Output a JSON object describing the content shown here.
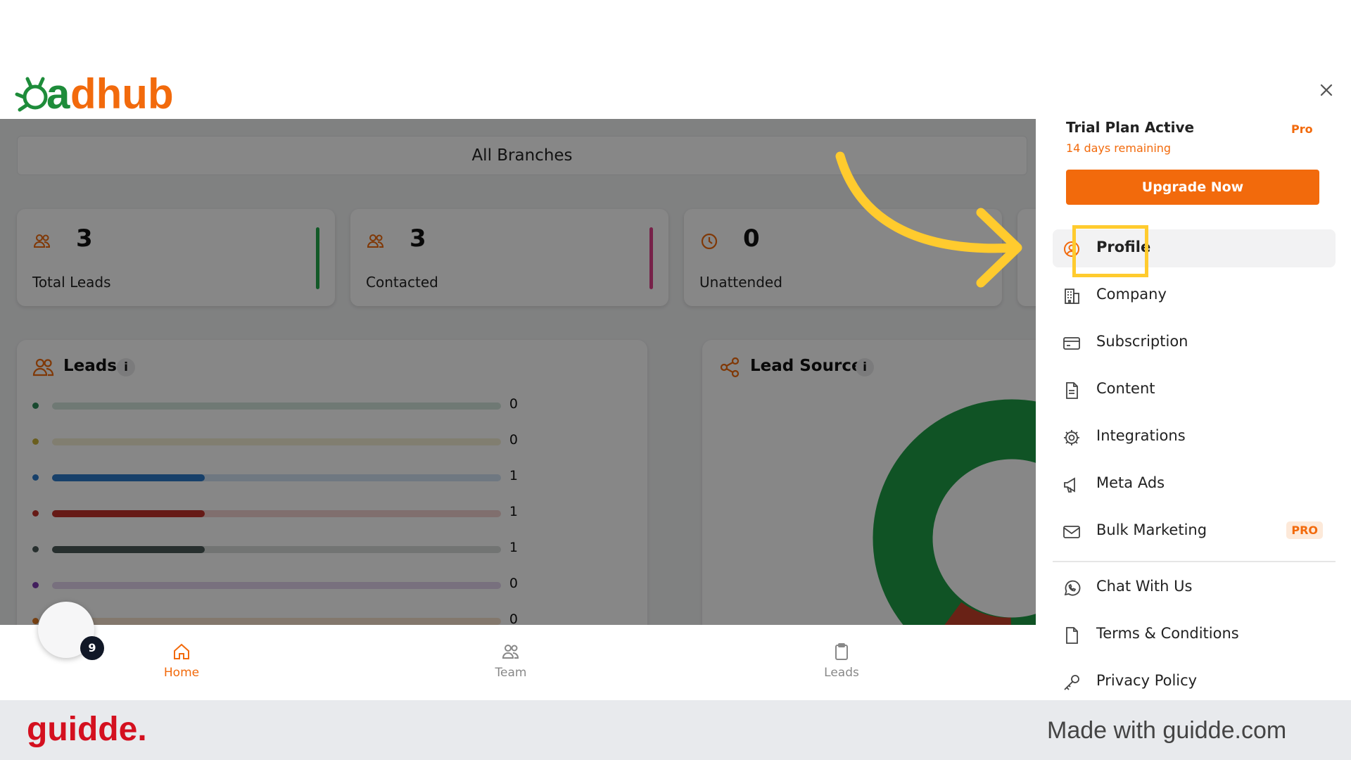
{
  "app": {
    "logo_text": "adhub",
    "brand_color": "#f26a0c",
    "logo_green": "#1e8c3a"
  },
  "filter": {
    "branch_label": "All Branches"
  },
  "stats": [
    {
      "value": "3",
      "label": "Total Leads",
      "icon": "users-icon",
      "bar_color": "#22a84b"
    },
    {
      "value": "3",
      "label": "Contacted",
      "icon": "users-icon",
      "bar_color": "#e0408a"
    },
    {
      "value": "0",
      "label": "Unattended",
      "icon": "clock-icon",
      "bar_color": "#e0a020"
    }
  ],
  "leads_panel": {
    "title": "Leads",
    "info": "i",
    "rows": [
      {
        "value": "0",
        "fraction": 0,
        "color": "#2e8a5a"
      },
      {
        "value": "0",
        "fraction": 0,
        "color": "#c9b23a"
      },
      {
        "value": "1",
        "fraction": 0.34,
        "color": "#2c79c9"
      },
      {
        "value": "1",
        "fraction": 0.34,
        "color": "#c0322a"
      },
      {
        "value": "1",
        "fraction": 0.34,
        "color": "#4a5a58"
      },
      {
        "value": "0",
        "fraction": 0,
        "color": "#7d3cb0"
      },
      {
        "value": "0",
        "fraction": 0,
        "color": "#e07a22"
      }
    ]
  },
  "lead_source_panel": {
    "title": "Lead Source",
    "info": "i"
  },
  "bottom_nav": {
    "home": "Home",
    "team": "Team",
    "leads": "Leads",
    "notification_count": "9"
  },
  "drawer": {
    "plan_title": "Trial Plan Active",
    "plan_badge": "Pro",
    "days_remaining": "14 days remaining",
    "upgrade_button": "Upgrade Now",
    "menu": [
      {
        "label": "Profile",
        "icon": "user-circle-icon"
      },
      {
        "label": "Company",
        "icon": "building-icon"
      },
      {
        "label": "Subscription",
        "icon": "credit-card-icon"
      },
      {
        "label": "Content",
        "icon": "document-icon"
      },
      {
        "label": "Integrations",
        "icon": "gear-icon"
      },
      {
        "label": "Meta Ads",
        "icon": "megaphone-icon"
      },
      {
        "label": "Bulk Marketing",
        "icon": "mail-icon",
        "badge": "PRO"
      }
    ],
    "secondary_menu": [
      {
        "label": "Chat With Us",
        "icon": "whatsapp-icon"
      },
      {
        "label": "Terms & Conditions",
        "icon": "document-icon"
      },
      {
        "label": "Privacy Policy",
        "icon": "key-icon"
      }
    ]
  },
  "footer": {
    "brand": "guidde.",
    "made_with": "Made with guidde.com"
  }
}
